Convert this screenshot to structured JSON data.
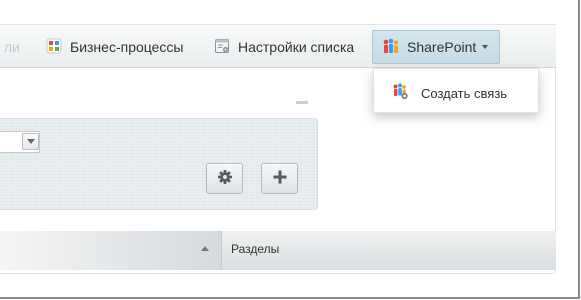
{
  "toolbar": {
    "faded_label": "ли",
    "business_processes_label": "Бизнес-процессы",
    "list_settings_label": "Настройки списка",
    "sharepoint_label": "SharePoint"
  },
  "sharepoint_menu": {
    "items": [
      {
        "label": "Создать связь",
        "icon": "sharepoint-link-icon"
      }
    ]
  },
  "filter": {
    "buttons": [
      {
        "icon": "gear-icon"
      },
      {
        "icon": "plus-icon"
      }
    ]
  },
  "grid": {
    "columns": [
      {
        "label": ""
      },
      {
        "label": "Разделы"
      }
    ]
  },
  "colors": {
    "active_tab_bg": "#c9dee8",
    "toolbar_bg": "#eef1f2",
    "filter_bg": "#e8edef",
    "header_bg": "#e3e6e8"
  }
}
